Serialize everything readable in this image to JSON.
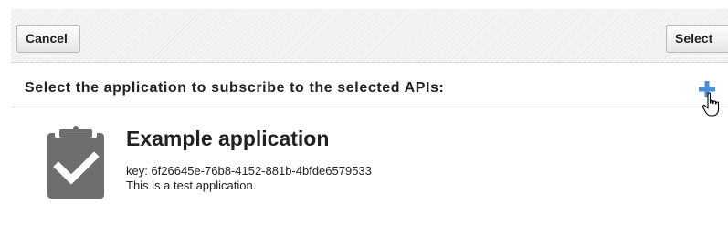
{
  "toolbar": {
    "cancel_label": "Cancel",
    "select_label": "Select"
  },
  "heading": "Select the application to subscribe to the selected APIs:",
  "icons": {
    "add": "plus-icon",
    "cursor": "hand-pointer-cursor",
    "application": "clipboard-check-icon"
  },
  "colors": {
    "accent": "#4a90d9",
    "icon_gray": "#6e6e6e"
  },
  "application": {
    "name": "Example application",
    "key": "key: 6f26645e-76b8-4152-881b-4bfde6579533",
    "description": "This is a test application."
  }
}
